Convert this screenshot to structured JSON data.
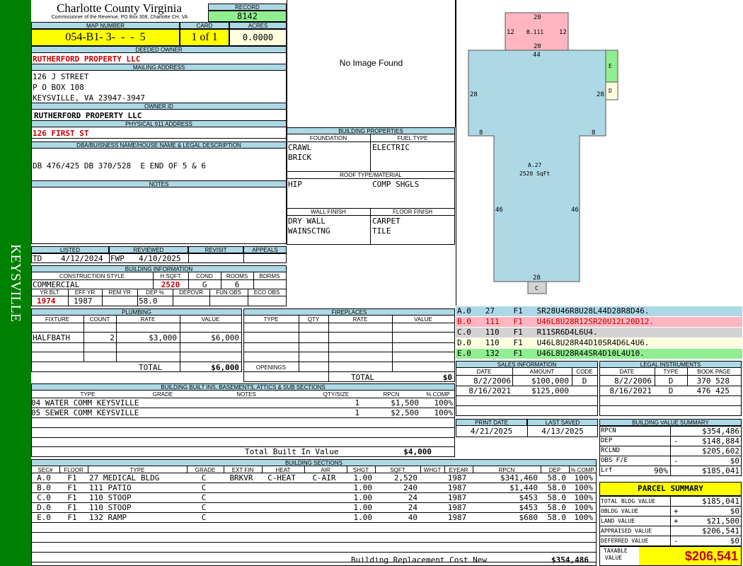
{
  "sidebar": {
    "label": "KEYSVILLE",
    "color": "#008000"
  },
  "header": {
    "county": "Charlotte County Virginia",
    "commissioner": "Commissioner of the Revenue, PO Box 308, Charlotte CH, VA",
    "record_label": "RECORD",
    "record": "8142",
    "map_label": "MAP NUMBER",
    "map_number": "054-B1- 3-  -  -  5",
    "card_label": "CARD",
    "card": "1 of 1",
    "acres_label": "ACRES",
    "acres": "0.0000"
  },
  "owner": {
    "deeded_label": "DEEDED OWNER",
    "deeded_owner": "RUTHERFORD PROPERTY LLC",
    "mailing_label": "MAILING ADDRESS",
    "address1": "126 J STREET",
    "address2": "P O BOX 108",
    "address3": "KEYSVILLE, VA 23947-3947",
    "owner_id_label": "OWNER ID",
    "owner_id": "RUTHERFORD PROPERTY LLC",
    "physical_label": "PHYSICAL 911 ADDRESS",
    "physical": "126 FIRST ST",
    "legal_label": "DBA/BUISNESS NAME/HOUSE NAME & LEGAL DESCRIPTION",
    "legal": "DB 476/425 DB 370/528  E END OF 5 & 6",
    "notes_label": "NOTES"
  },
  "image": {
    "no_image": "No Image Found"
  },
  "building_props": {
    "title": "BUILDING PROPERTIES",
    "foundation_label": "FOUNDATION",
    "foundation1": "CRAWL",
    "foundation2": "BRICK",
    "fuel_label": "FUEL TYPE",
    "fuel": "ELECTRIC",
    "roof_label": "ROOF TYPE/MATERIAL",
    "roof_type": "HIP",
    "roof_material": "COMP SHGLS",
    "wall_label": "WALL FINISH",
    "wall1": "DRY WALL",
    "wall2": "WAINSCTNG",
    "floor_label": "FLOOR FINISH",
    "floor1": "CARPET",
    "floor2": "TILE"
  },
  "sketch": {
    "a_label": "A.27",
    "a_area": "2520 SqFt",
    "b_label": "B.111",
    "dims": {
      "b_top": "20",
      "b_bottom": "20",
      "b_left": "12",
      "b_right": "12",
      "a_top": "44",
      "a_left_upper": "28",
      "a_right_upper": "28",
      "a_left_step": "8",
      "a_right_step": "8",
      "a_left_lower": "46",
      "a_right_lower": "46",
      "a_bottom": "28"
    },
    "e_label": "E",
    "d_label": "D",
    "c_label": "C",
    "colors": {
      "a": "#add8e6",
      "b": "#ffb6c1",
      "c": "#d3d3d3",
      "d": "#ffffe0",
      "e": "#90ee90"
    }
  },
  "codes": [
    {
      "text": "A.0   27    F1   SR28U46R8U28L44D28R8D46.",
      "color": "#add8e6"
    },
    {
      "text": "B.0   111   F1   U46L8U28R12SR20U12L20D12.",
      "color": "#ffb6c1"
    },
    {
      "text": "C.0   110   F1   R11SR6D4L6U4.",
      "color": "#d3d3d3"
    },
    {
      "text": "D.0   110   F1   U46L8U28R44D10SR4D6L4U6.",
      "color": "#ffffe0"
    },
    {
      "text": "E.0   132   F1   U46L8U28R44SR4D10L4U10.",
      "color": "#90ee90"
    }
  ],
  "listing": {
    "listed_label": "LISTED",
    "listed_by": "TD",
    "listed_date": "4/12/2024",
    "reviewed_label": "REVIEWED",
    "reviewed_by": "FWP",
    "reviewed_date": "4/10/2025",
    "revisit_label": "REVISIT",
    "appeals_label": "APPEALS"
  },
  "building_info": {
    "title": "BUILDING INFORMATION",
    "style_label": "CONSTRUCTION STYLE",
    "style": "COMMERCIAL",
    "hsqft_label": "H SQFT",
    "hsqft": "2520",
    "cond_label": "COND",
    "cond": "G",
    "rooms_label": "ROOMS",
    "rooms": "6",
    "bdrms_label": "BDRMS",
    "yrblt_label": "YR BLT",
    "yrblt": "1974",
    "effyr_label": "EFF YR",
    "effyr": "1987",
    "remyr_label": "REM YR",
    "dep_label": "DEP %",
    "dep": "58.0",
    "depovr_label": "DEPOVR",
    "funobs_label": "FUN OBS",
    "ecoobs_label": "ECO OBS"
  },
  "plumbing": {
    "title": "PLUMBING",
    "headers": [
      "FIXTURE",
      "COUNT",
      "RATE",
      "VALUE"
    ],
    "rows": [
      {
        "fixture": "HALFBATH",
        "count": "2",
        "rate": "$3,000",
        "value": "$6,000"
      }
    ],
    "total_label": "TOTAL",
    "total": "$6,000"
  },
  "fireplaces": {
    "title": "FIREPLACES",
    "headers": [
      "TYPE",
      "QTY",
      "RATE",
      "VALUE"
    ],
    "openings_label": "OPENINGS",
    "total_label": "TOTAL",
    "total": "$0"
  },
  "builtins": {
    "title": "BUILDING BUILT INS, BASEMENTS, ATTICS & SUB SECTIONS",
    "headers": [
      "TYPE",
      "GRADE",
      "NOTES",
      "QTY/SIZE",
      "RPCN",
      "% COMP"
    ],
    "rows": [
      {
        "type": "04 WATER COMM KEYSVILLE",
        "qty": "1",
        "rpcn": "$1,500",
        "comp": "100%"
      },
      {
        "type": "05 SEWER COMM KEYSVILLE",
        "qty": "1",
        "rpcn": "$2,500",
        "comp": "100%"
      }
    ],
    "total_label": "Total Built In Value",
    "total": "$4,000"
  },
  "sections": {
    "title": "BUILDING SECTIONS",
    "headers": [
      "SEC#",
      "FLOOR",
      "TYPE",
      "GRADE",
      "EXT FIN",
      "HEAT",
      "AIR",
      "SHGT",
      "SQFT",
      "WHGT",
      "EYEAR",
      "RPCN",
      "DEP",
      "% COMP"
    ],
    "rows": [
      {
        "sec": "A.0",
        "floor": "F1",
        "type": "27 MEDICAL BLDG",
        "grade": "C",
        "ext": "BRKVR",
        "heat": "C-HEAT",
        "air": "C-AIR",
        "shgt": "1.00",
        "sqft": "2,520",
        "eyear": "1987",
        "rpcn": "$341,460",
        "dep": "58.0",
        "comp": "100%"
      },
      {
        "sec": "B.0",
        "floor": "F1",
        "type": "111 PATIO",
        "grade": "C",
        "ext": "",
        "heat": "",
        "air": "",
        "shgt": "1.00",
        "sqft": "240",
        "eyear": "1987",
        "rpcn": "$1,440",
        "dep": "58.0",
        "comp": "100%"
      },
      {
        "sec": "C.0",
        "floor": "F1",
        "type": "110 STOOP",
        "grade": "C",
        "ext": "",
        "heat": "",
        "air": "",
        "shgt": "1.00",
        "sqft": "24",
        "eyear": "1987",
        "rpcn": "$453",
        "dep": "58.0",
        "comp": "100%"
      },
      {
        "sec": "D.0",
        "floor": "F1",
        "type": "110 STOOP",
        "grade": "C",
        "ext": "",
        "heat": "",
        "air": "",
        "shgt": "1.00",
        "sqft": "24",
        "eyear": "1987",
        "rpcn": "$453",
        "dep": "58.0",
        "comp": "100%"
      },
      {
        "sec": "E.0",
        "floor": "F1",
        "type": "132 RAMP",
        "grade": "C",
        "ext": "",
        "heat": "",
        "air": "",
        "shgt": "1.00",
        "sqft": "40",
        "eyear": "1987",
        "rpcn": "$680",
        "dep": "58.0",
        "comp": "100%"
      }
    ],
    "total_label": "Building Replacement Cost New",
    "total": "$354,486"
  },
  "sales": {
    "title": "SALES INFORMATION",
    "headers": [
      "DATE",
      "AMOUNT",
      "CODE"
    ],
    "rows": [
      {
        "date": "8/2/2006",
        "amount": "$100,000",
        "code": "D"
      },
      {
        "date": "8/16/2021",
        "amount": "$125,000",
        "code": ""
      }
    ]
  },
  "legal_instr": {
    "title": "LEGAL INSTRUMENTS",
    "headers": [
      "DATE",
      "TYPE",
      "BOOK PAGE"
    ],
    "rows": [
      {
        "date": "8/2/2006",
        "type": "D",
        "book": "370 528"
      },
      {
        "date": "8/16/2021",
        "type": "D",
        "book": "476 425"
      }
    ]
  },
  "dates": {
    "print_label": "PRINT DATE",
    "print": "4/21/2025",
    "saved_label": "LAST SAVED",
    "saved": "4/13/2025"
  },
  "bvs": {
    "title": "BUILDING VALUE SUMMARY",
    "rows": [
      {
        "label": "RPCN",
        "sign": "",
        "value": "$354,486"
      },
      {
        "label": "DEP",
        "sign": "-",
        "value": "$148,884"
      },
      {
        "label": "RCLND",
        "sign": "",
        "value": "$205,602"
      },
      {
        "label": "OBS F/E",
        "sign": "-",
        "value": "$0"
      },
      {
        "label": "Lrf",
        "pct": "90%",
        "sign": "",
        "value": "$185,041"
      }
    ]
  },
  "parcel": {
    "title": "PARCEL SUMMARY",
    "rows": [
      {
        "label": "TOTAL BLDG VALUE",
        "sign": "",
        "value": "$185,041"
      },
      {
        "label": "OBLDG VALUE",
        "sign": "+",
        "value": "$0"
      },
      {
        "label": "LAND VALUE",
        "sign": "+",
        "value": "$21,500"
      },
      {
        "label": "APPRAISED VALUE",
        "sign": "",
        "value": "$206,541"
      },
      {
        "label": "DEFERRED VALUE",
        "sign": "-",
        "value": "$0"
      }
    ],
    "taxable_label1": "TAXABLE",
    "taxable_label2": "VALUE",
    "taxable": "$206,541"
  }
}
